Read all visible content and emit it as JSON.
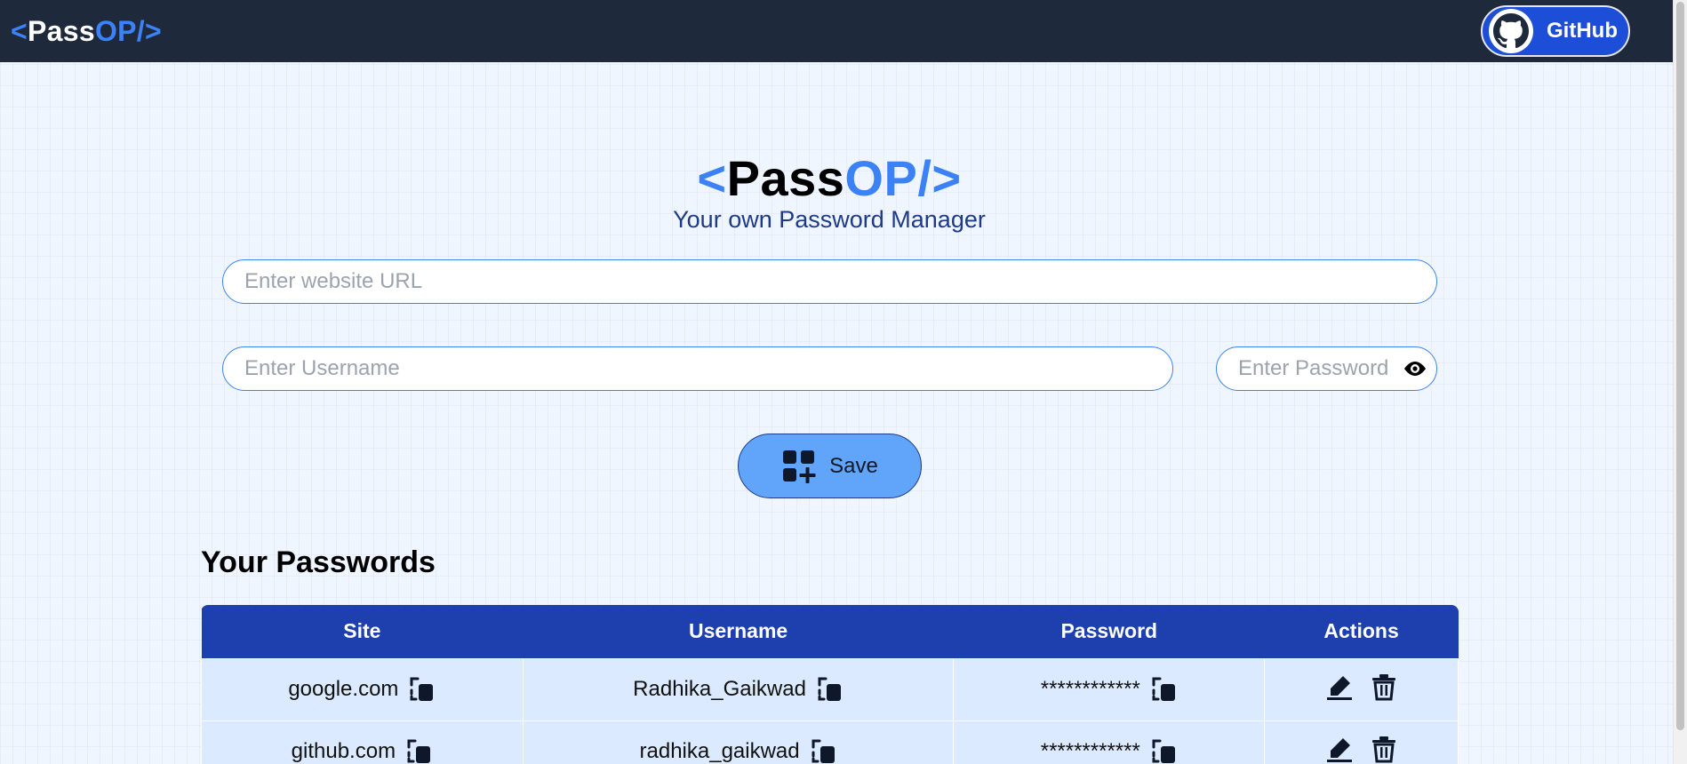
{
  "navbar": {
    "brand": {
      "open": "<",
      "pass": "Pass",
      "op": "OP/",
      "close": ">"
    },
    "github_label": "GitHub"
  },
  "hero": {
    "brand": {
      "open": "<",
      "pass": "Pass",
      "op": "OP/",
      "close": ">"
    },
    "tagline": "Your own Password Manager"
  },
  "form": {
    "url_placeholder": "Enter website URL",
    "username_placeholder": "Enter Username",
    "password_placeholder": "Enter Password",
    "save_label": "Save"
  },
  "passwords": {
    "title": "Your Passwords",
    "headers": [
      "Site",
      "Username",
      "Password",
      "Actions"
    ],
    "rows": [
      {
        "site": "google.com",
        "username": "Radhika_Gaikwad",
        "password": "************"
      },
      {
        "site": "github.com",
        "username": "radhika_gaikwad",
        "password": "************"
      }
    ]
  },
  "colors": {
    "navbar_bg": "#1e293b",
    "accent": "#3b82f6",
    "table_header": "#1e40af",
    "table_row": "#dbeafe",
    "save_button": "#60a5fa"
  },
  "icons": [
    "github-icon",
    "eye-icon",
    "save-icon",
    "copy-icon",
    "edit-icon",
    "delete-icon"
  ]
}
